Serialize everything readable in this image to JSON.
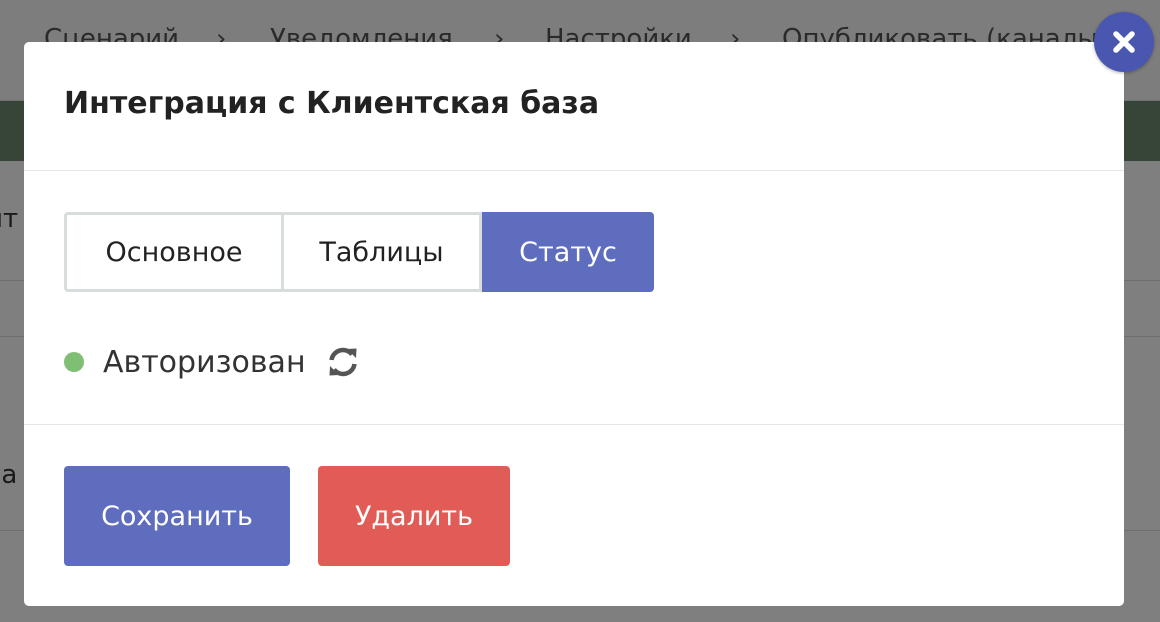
{
  "background": {
    "steps": [
      "Сценарий",
      "Уведомления",
      "Настройки",
      "Опубликовать (каналы)"
    ],
    "step_separator": "›",
    "left_fragments": [
      "нт",
      "ва"
    ]
  },
  "modal": {
    "title": "Интеграция с Клиентская база",
    "tabs": [
      {
        "label": "Основное",
        "active": false
      },
      {
        "label": "Таблицы",
        "active": false
      },
      {
        "label": "Статус",
        "active": true
      }
    ],
    "status": {
      "text": "Авторизован",
      "dot_color": "#7fbf73",
      "refresh_icon": "refresh-icon"
    },
    "buttons": {
      "save_label": "Сохранить",
      "delete_label": "Удалить"
    },
    "close_icon": "close-icon"
  },
  "colors": {
    "primary": "#5e6dbd",
    "danger": "#e15c57",
    "close_button": "#4a57b0",
    "status_ok": "#7fbf73"
  }
}
